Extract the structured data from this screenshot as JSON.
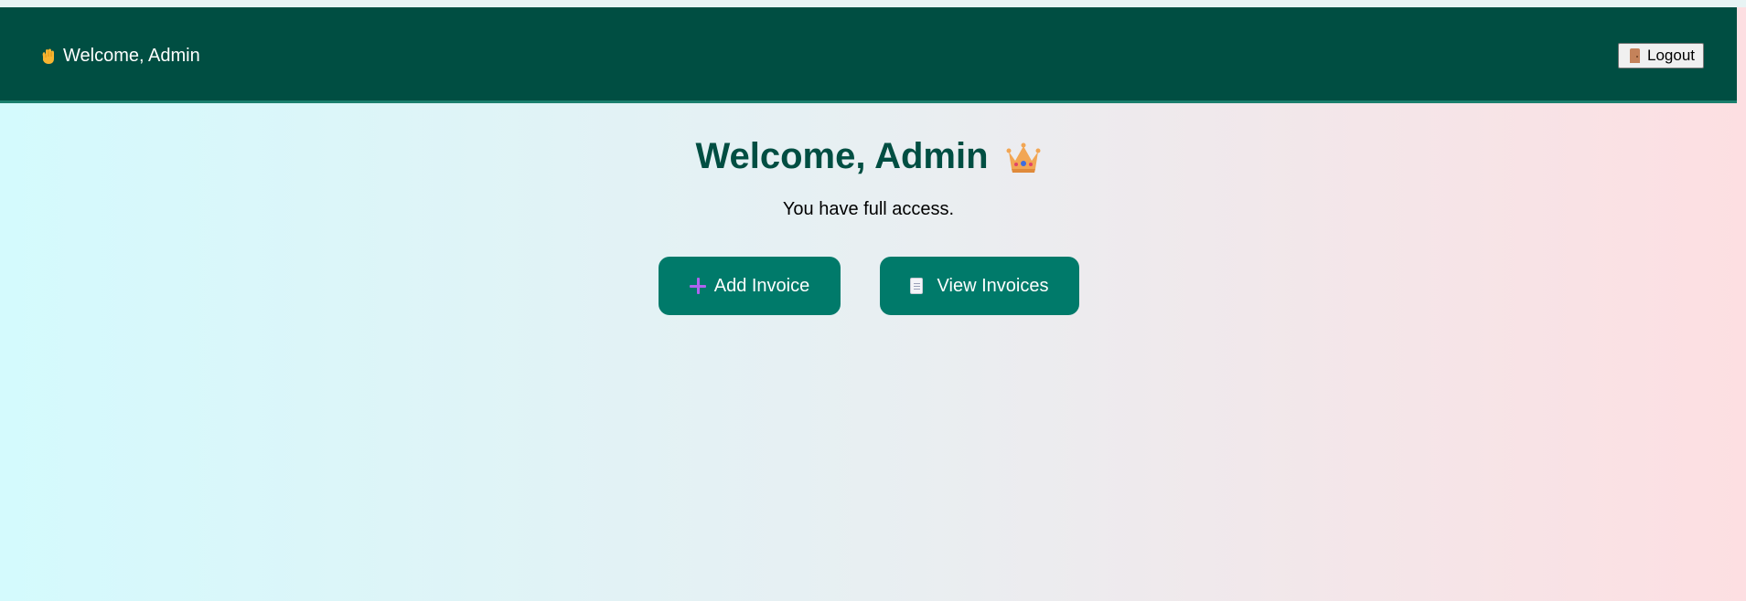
{
  "navbar": {
    "welcome_text": "Welcome, Admin",
    "welcome_icon": "waving-hand-icon",
    "logout_label": "Logout",
    "logout_icon": "door-icon",
    "background_color": "#004e42"
  },
  "main": {
    "title": "Welcome, Admin",
    "title_icon": "crown-icon",
    "subtitle": "You have full access.",
    "buttons": [
      {
        "label": "Add Invoice",
        "icon": "plus-icon"
      },
      {
        "label": "View Invoices",
        "icon": "document-icon"
      }
    ],
    "title_color": "#004e42",
    "button_color": "#007a6a"
  }
}
